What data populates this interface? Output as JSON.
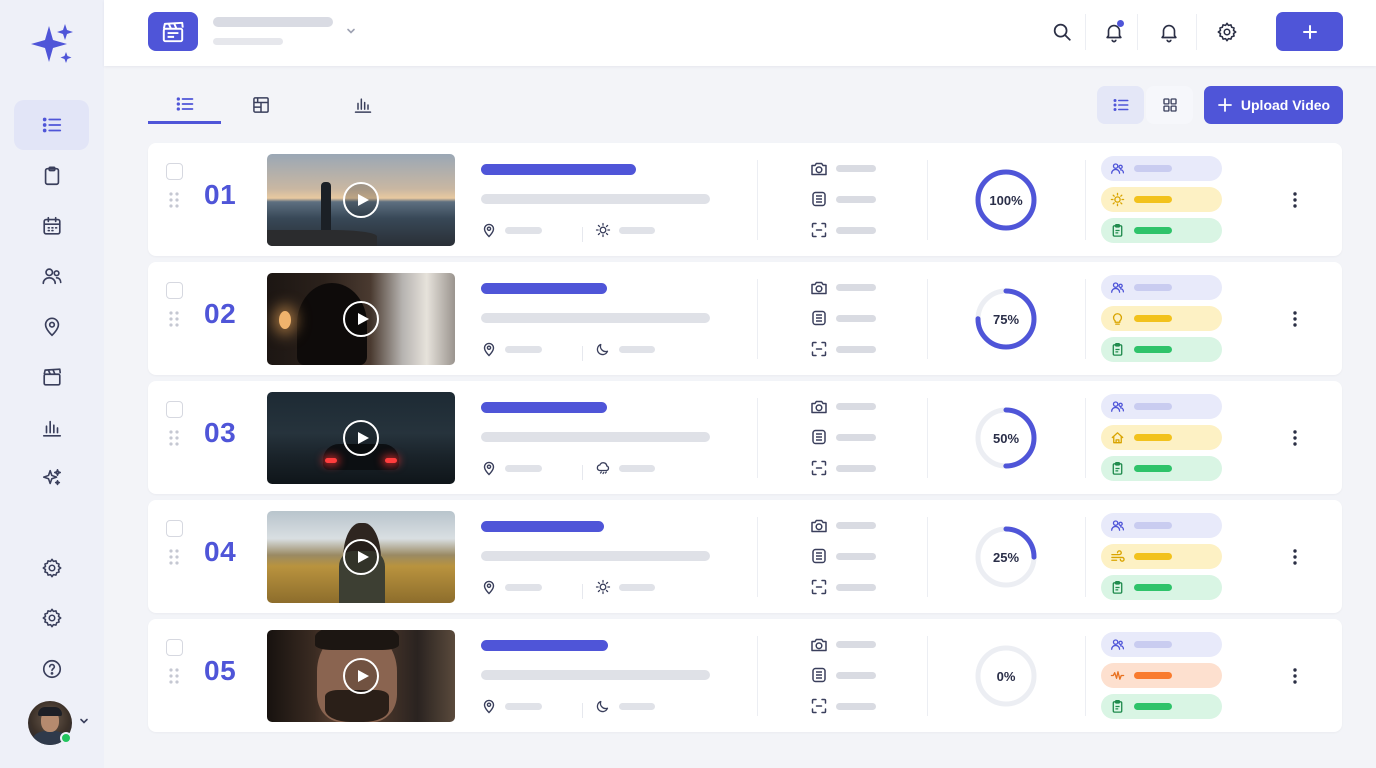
{
  "header": {
    "app_icon": "clapperboard-icon",
    "actions": [
      "search-icon",
      "notification-bell-icon",
      "bell-icon",
      "gear-icon",
      "plus-icon"
    ]
  },
  "sidebar": {
    "items": [
      {
        "icon": "list-icon",
        "active": true
      },
      {
        "icon": "clipboard-icon"
      },
      {
        "icon": "calendar-icon"
      },
      {
        "icon": "users-icon"
      },
      {
        "icon": "location-pin-icon"
      },
      {
        "icon": "clapperboard-icon"
      },
      {
        "icon": "bar-chart-icon"
      },
      {
        "icon": "sparkles-icon"
      },
      {
        "icon": "gear-icon"
      },
      {
        "icon": "gear-icon"
      },
      {
        "icon": "help-icon"
      }
    ]
  },
  "toolbar": {
    "tabs": [
      "list-icon",
      "storyboard-icon",
      "bar-chart-icon"
    ],
    "upload_label": "Upload Video"
  },
  "colors": {
    "accent": "#4f55d8",
    "tag_people": "#e8eafa",
    "tag_light": "#fdf1c4",
    "tag_clip": "#d9f5e4",
    "tag_sound": "#fde0cf"
  },
  "scenes": [
    {
      "number": "01",
      "progress": 100,
      "progress_label": "100%",
      "weather_icon": "sun-icon",
      "light_icon": "sun-icon",
      "light_tag": "yellow"
    },
    {
      "number": "02",
      "progress": 75,
      "progress_label": "75%",
      "weather_icon": "moon-icon",
      "light_icon": "lightbulb-icon",
      "light_tag": "yellow"
    },
    {
      "number": "03",
      "progress": 50,
      "progress_label": "50%",
      "weather_icon": "rain-cloud-icon",
      "light_icon": "house-icon",
      "light_tag": "yellow"
    },
    {
      "number": "04",
      "progress": 25,
      "progress_label": "25%",
      "weather_icon": "sun-icon",
      "light_icon": "wind-icon",
      "light_tag": "yellow"
    },
    {
      "number": "05",
      "progress": 0,
      "progress_label": "0%",
      "weather_icon": "moon-icon",
      "light_icon": "waveform-icon",
      "light_tag": "orange"
    }
  ]
}
